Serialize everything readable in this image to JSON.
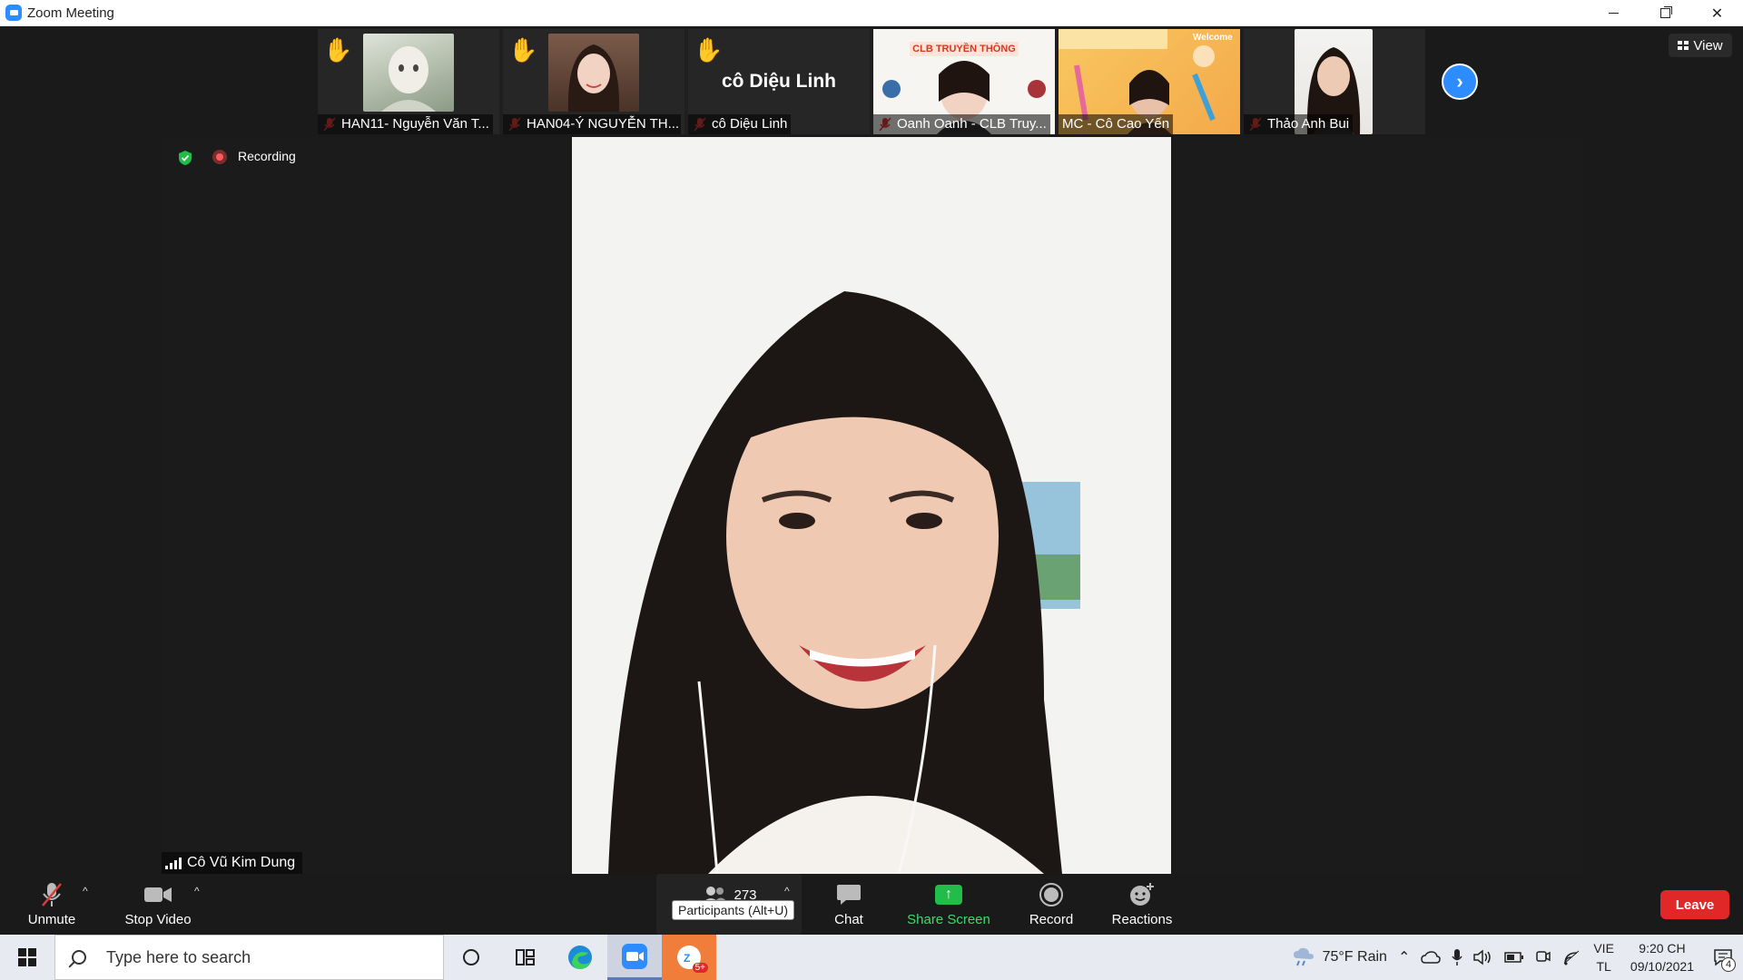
{
  "window": {
    "title": "Zoom Meeting"
  },
  "thumbnails": [
    {
      "name": "HAN11- Nguyễn Văn T...",
      "hand_raised": true,
      "muted": true
    },
    {
      "name": "HAN04-Ý NGUYỄN TH...",
      "hand_raised": true,
      "muted": true
    },
    {
      "name": "cô Diệu Linh",
      "hand_raised": true,
      "muted": true,
      "display_text": "cô Diệu Linh"
    },
    {
      "name": "Oanh Oanh - CLB Truy...",
      "hand_raised": false,
      "muted": true,
      "banner_text": "CLB TRUYỀN THÔNG"
    },
    {
      "name": "MC - Cô Cao Yến",
      "hand_raised": false,
      "muted": false,
      "banner_text": "Welcome"
    },
    {
      "name": "Thảo Anh Bui",
      "hand_raised": false,
      "muted": true
    }
  ],
  "view_button": {
    "label": "View"
  },
  "recording": {
    "label": "Recording"
  },
  "speaker": {
    "name": "Cô Vũ Kim Dung"
  },
  "toolbar": {
    "unmute_label": "Unmute",
    "stop_video_label": "Stop Video",
    "participants_count": "273",
    "participants_tooltip": "Participants (Alt+U)",
    "chat_label": "Chat",
    "share_screen_label": "Share Screen",
    "record_label": "Record",
    "reactions_label": "Reactions",
    "leave_label": "Leave"
  },
  "taskbar": {
    "search_placeholder": "Type here to search",
    "zoom_badge": "5+",
    "weather": "75°F  Rain",
    "language_top": "VIE",
    "language_bottom": "TL",
    "time": "9:20 CH",
    "date": "09/10/2021",
    "notification_count": "4"
  },
  "colors": {
    "zoom_blue": "#2d8cff",
    "leave_red": "#e02828",
    "share_green": "#21bc4a",
    "recording_red": "#ff5a5a"
  }
}
